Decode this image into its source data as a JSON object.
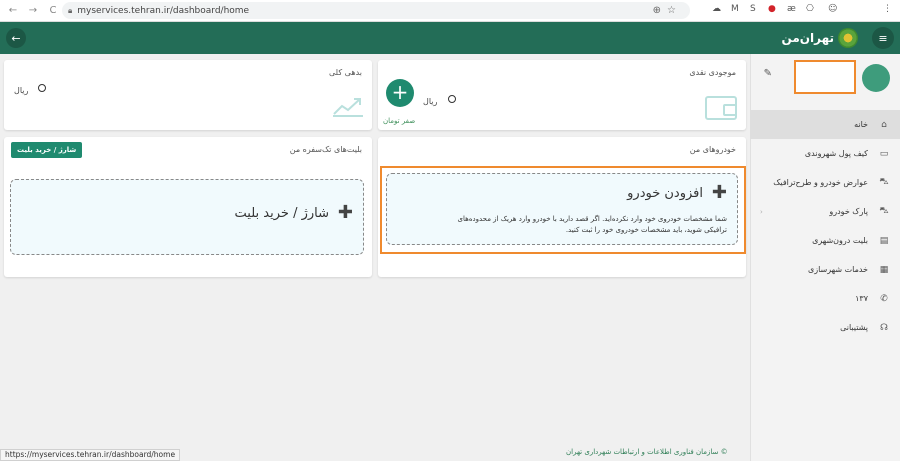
{
  "browser": {
    "url": "myservices.tehran.ir/dashboard/home",
    "status_url": "https://myservices.tehran.ir/dashboard/home",
    "nav_back": "←",
    "nav_forward": "→",
    "nav_reload": "C"
  },
  "header": {
    "brand": "تهران‌من",
    "back_icon": "←",
    "menu_icon": "≡"
  },
  "profile": {
    "edit_icon": "✎"
  },
  "sidebar": {
    "items": [
      {
        "label": "خانه",
        "icon": "⌂"
      },
      {
        "label": "کیف پول شهروندی",
        "icon": "▭"
      },
      {
        "label": "عوارض خودرو و طرح‌ترافیک",
        "icon": "⛍"
      },
      {
        "label": "پارک خودرو",
        "icon": "⛍"
      },
      {
        "label": "بلیت درون‌شهری",
        "icon": "▤"
      },
      {
        "label": "خدمات شهرسازی",
        "icon": "▦"
      },
      {
        "label": "۱۳۷",
        "icon": "✆"
      },
      {
        "label": "پشتیبانی",
        "icon": "☊"
      }
    ]
  },
  "cash_card": {
    "title": "موجودی نقدی",
    "currency": "ریال",
    "zero_text": "صفر تومان",
    "add_icon": "+"
  },
  "debt_card": {
    "title": "بدهی کلی",
    "currency": "ریال"
  },
  "cars_card": {
    "title": "خودروهای من",
    "add_title": "افزودن خودرو",
    "add_desc_line1": "شما مشخصات خودروی خود وارد نکرده‌اید. اگر قصد دارید با خودرو وارد هریک از محدوده‌های",
    "add_desc_line2": "ترافیکی شوید، باید مشخصات خودروی خود را ثبت کنید.",
    "plus_icon": "✚"
  },
  "tickets_card": {
    "title": "بلیت‌های تک‌سفره من",
    "buy_button": "شارژ / خرید بلیت",
    "box_title": "شارژ / خرید بلیت",
    "plus_icon": "✚"
  },
  "footer": {
    "copyright": "© سازمان فناوری اطلاعات و ارتباطات شهرداری تهران"
  }
}
